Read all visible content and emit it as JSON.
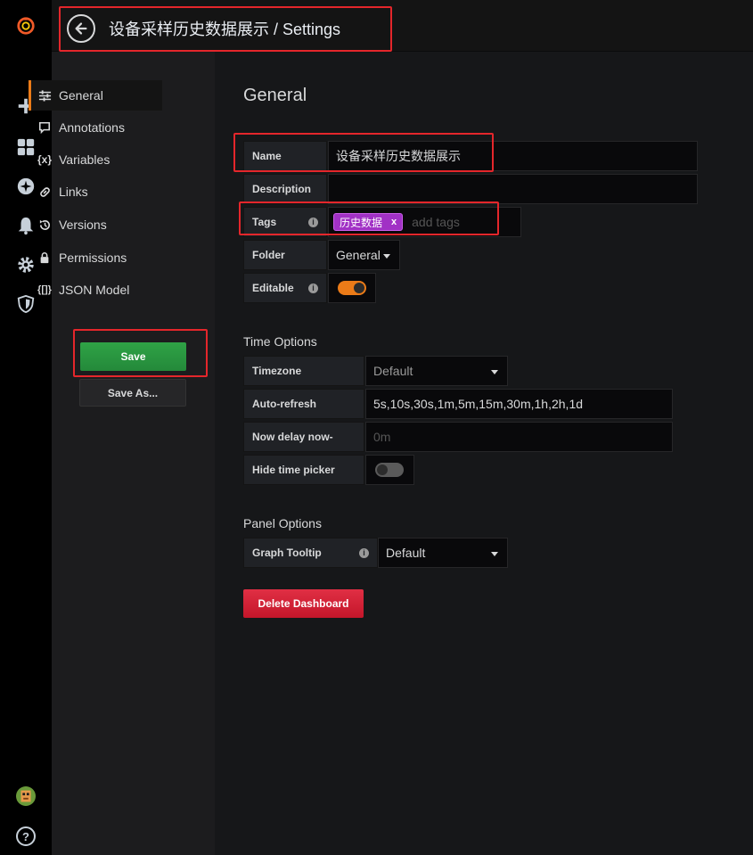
{
  "header": {
    "breadcrumb": "设备采样历史数据展示 / Settings"
  },
  "rail": {
    "icons": [
      "grafana-logo-icon",
      "plus-icon",
      "dashboards-icon",
      "explore-icon",
      "bell-icon",
      "gear-icon",
      "shield-icon",
      "avatar",
      "help-icon"
    ],
    "help_label": "?"
  },
  "sidenav": {
    "items": [
      {
        "label": "General",
        "icon": "sliders-icon"
      },
      {
        "label": "Annotations",
        "icon": "comment-icon"
      },
      {
        "label": "Variables",
        "icon": "variable-icon"
      },
      {
        "label": "Links",
        "icon": "link-icon"
      },
      {
        "label": "Versions",
        "icon": "history-icon"
      },
      {
        "label": "Permissions",
        "icon": "lock-icon"
      },
      {
        "label": "JSON Model",
        "icon": "json-icon"
      }
    ],
    "variables_glyph": "{x}",
    "json_glyph": "{[]}",
    "save_label": "Save",
    "save_as_label": "Save As..."
  },
  "general": {
    "title": "General",
    "name_label": "Name",
    "name_value": "设备采样历史数据展示",
    "description_label": "Description",
    "description_value": "",
    "tags_label": "Tags",
    "tags": [
      "历史数据"
    ],
    "tag_remove": "x",
    "tags_placeholder": "add tags",
    "folder_label": "Folder",
    "folder_value": "General",
    "editable_label": "Editable",
    "editable_on": true,
    "info_glyph": "i"
  },
  "time_options": {
    "title": "Time Options",
    "timezone_label": "Timezone",
    "timezone_value": "Default",
    "autorefresh_label": "Auto-refresh",
    "autorefresh_value": "5s,10s,30s,1m,5m,15m,30m,1h,2h,1d",
    "nowdelay_label": "Now delay now-",
    "nowdelay_placeholder": "0m",
    "hide_picker_label": "Hide time picker",
    "hide_picker_on": false
  },
  "panel_options": {
    "title": "Panel Options",
    "tooltip_label": "Graph Tooltip",
    "tooltip_value": "Default"
  },
  "delete_label": "Delete Dashboard",
  "colors": {
    "accent": "#eb7b18",
    "save_green": "#2fa346",
    "delete_red": "#e02f44",
    "tag_purple": "#a131c5",
    "highlight_red": "#e4262b"
  }
}
